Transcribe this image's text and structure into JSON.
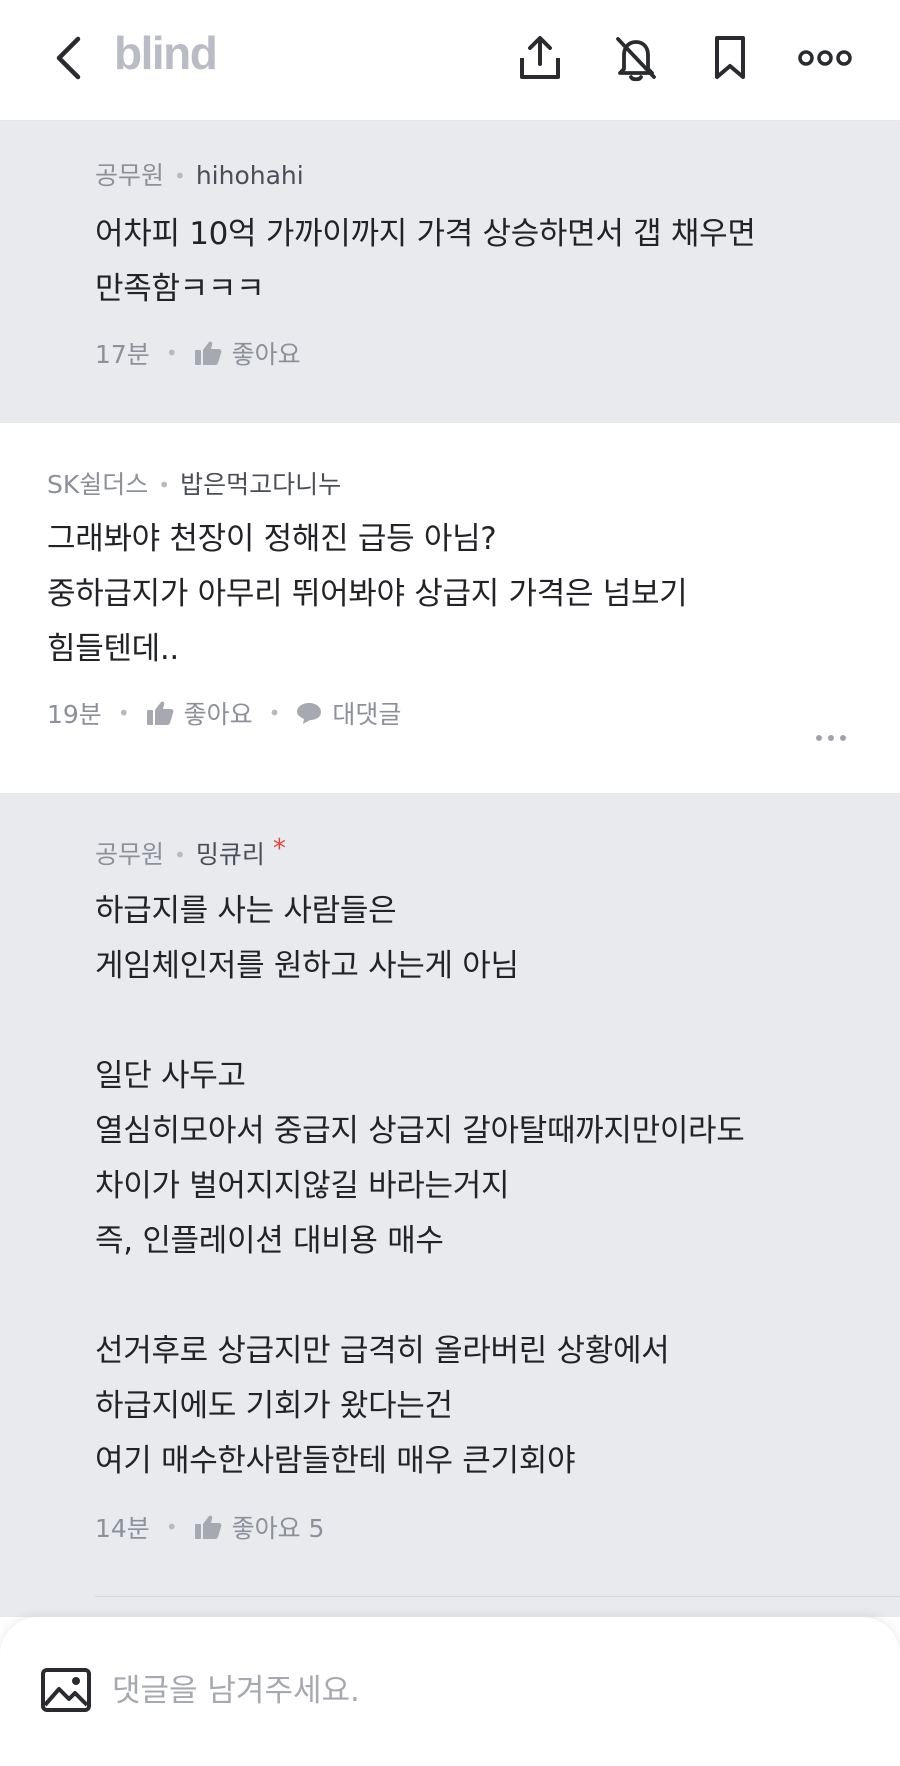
{
  "header": {
    "brand": "blind",
    "icons": [
      "back-chevron-icon",
      "share-icon",
      "notification-off-icon",
      "bookmark-icon",
      "more-horizontal-icon"
    ]
  },
  "comments": [
    {
      "type": "reply",
      "company": "공무원",
      "nickname": "hihohahi",
      "text": "어차피 10억 가까이까지 가격 상승하면서 갭 채우면\n만족함ㅋㅋㅋ",
      "time": "17분",
      "like_label": "좋아요"
    },
    {
      "type": "top-level",
      "company": "SK쉴더스",
      "nickname": "밥은먹고다니누",
      "text": "그래봐야 천장이 정해진 급등 아님?\n중하급지가 아무리 뛰어봐야 상급지 가격은 넘보기\n힘들텐데..",
      "time": "19분",
      "like_label": "좋아요",
      "reply_label": "대댓글"
    },
    {
      "type": "reply",
      "company": "공무원",
      "nickname": "밍큐리",
      "author_mark": "*",
      "text": "하급지를 사는 사람들은\n게임체인저를 원하고 사는게 아님\n\n일단 사두고\n열심히모아서 중급지 상급지 갈아탈때까지만이라도\n차이가 벌어지지않길 바라는거지\n즉, 인플레이션 대비용 매수\n\n선거후로 상급지만 급격히 올라버린 상황에서\n하급지에도 기회가 왔다는건\n여기 매수한사람들한테 매우 큰기회야",
      "time": "14분",
      "like_label": "좋아요 5"
    }
  ],
  "composer": {
    "placeholder": "댓글을 남겨주세요."
  },
  "colors": {
    "reply_bg": "#e9eaee",
    "brand_gray": "#b9bcc4",
    "author_mark": "#e2453c"
  }
}
